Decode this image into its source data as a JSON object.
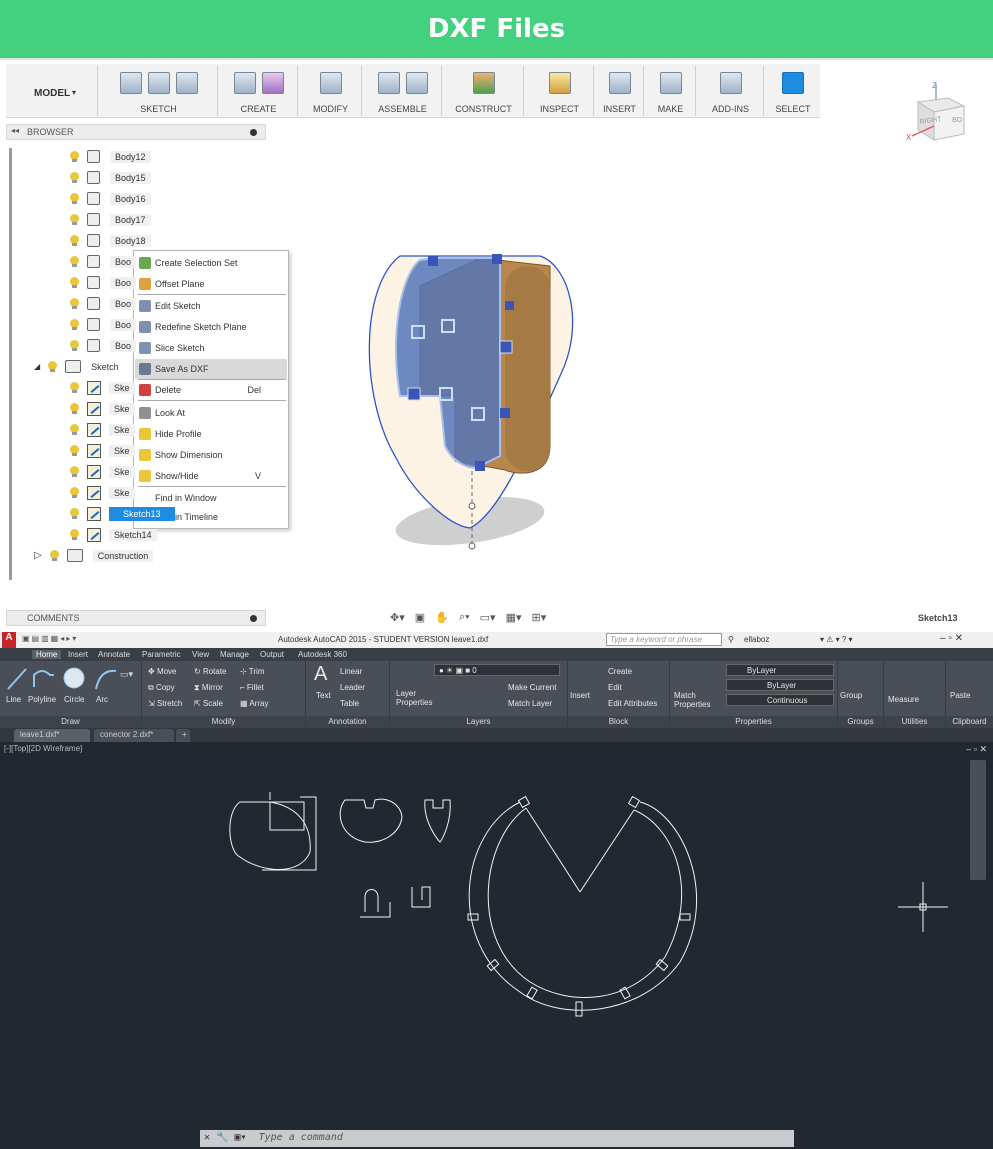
{
  "banner": {
    "title": "DXF Files"
  },
  "fusion": {
    "toolbar": {
      "workspace": "MODEL",
      "groups": [
        "SKETCH",
        "CREATE",
        "MODIFY",
        "ASSEMBLE",
        "CONSTRUCT",
        "INSPECT",
        "INSERT",
        "MAKE",
        "ADD-INS",
        "SELECT"
      ]
    },
    "viewcube": {
      "z": "Z",
      "x": "X",
      "face_right": "RIGHT",
      "face_back": "BO"
    },
    "browser": {
      "title": "BROWSER",
      "bodies": [
        "Body12",
        "Body15",
        "Body16",
        "Body17",
        "Body18",
        "Boo",
        "Boo",
        "Boo",
        "Boo",
        "Boo"
      ],
      "sketches_folder": "Sketch",
      "sketches": [
        "Ske",
        "Ske",
        "Ske",
        "Ske",
        "Ske",
        "Ske"
      ],
      "selected_sketch": "Sketch13",
      "next_sketch": "Sketch14",
      "construction": "Construction"
    },
    "context_menu": {
      "items": [
        {
          "label": "Create Selection Set",
          "shortcut": ""
        },
        {
          "label": "Offset Plane",
          "shortcut": ""
        },
        {
          "label": "Edit Sketch",
          "shortcut": ""
        },
        {
          "label": "Redefine Sketch Plane",
          "shortcut": ""
        },
        {
          "label": "Slice Sketch",
          "shortcut": ""
        },
        {
          "label": "Save As DXF",
          "shortcut": ""
        },
        {
          "label": "Delete",
          "shortcut": "Del"
        },
        {
          "label": "Look At",
          "shortcut": ""
        },
        {
          "label": "Hide Profile",
          "shortcut": ""
        },
        {
          "label": "Show Dimension",
          "shortcut": ""
        },
        {
          "label": "Show/Hide",
          "shortcut": "V"
        },
        {
          "label": "Find in Window",
          "shortcut": ""
        },
        {
          "label": "Find in Timeline",
          "shortcut": ""
        }
      ]
    },
    "comments": "COMMENTS",
    "active_sketch": "Sketch13"
  },
  "acad": {
    "title": "Autodesk AutoCAD 2015 - STUDENT VERSION   leave1.dxf",
    "search_placeholder": "Type a keyword or phrase",
    "user": "ellaboz",
    "tabs": [
      "Home",
      "Insert",
      "Annotate",
      "Parametric",
      "View",
      "Manage",
      "Output",
      "Autodesk 360"
    ],
    "draw": {
      "label": "Draw",
      "tools": [
        "Line",
        "Polyline",
        "Circle",
        "Arc"
      ]
    },
    "modify": {
      "label": "Modify",
      "tools": [
        "Move",
        "Rotate",
        "Trim",
        "Copy",
        "Mirror",
        "Fillet",
        "Stretch",
        "Scale",
        "Array"
      ]
    },
    "annotation": {
      "label": "Annotation",
      "tools": [
        "Text",
        "Linear",
        "Leader",
        "Table"
      ]
    },
    "layers": {
      "label": "Layers",
      "tools": [
        "Layer Properties",
        "Make Current",
        "Match Layer"
      ],
      "current_layer": "0"
    },
    "block": {
      "label": "Block",
      "tools": [
        "Insert",
        "Create",
        "Edit",
        "Edit Attributes"
      ]
    },
    "properties": {
      "label": "Properties",
      "match": "Match Properties",
      "color": "ByLayer",
      "linetype": "ByLayer",
      "lineweight": "Continuous"
    },
    "groups": {
      "label": "Groups",
      "tool": "Group"
    },
    "utilities": {
      "label": "Utilities",
      "tool": "Measure"
    },
    "clipboard": {
      "label": "Clipboard",
      "tool": "Paste"
    },
    "doc_tabs": [
      "leave1.dxf*",
      "conector 2.dxf*"
    ],
    "viewport_label": "[-][Top][2D Wireframe]",
    "command_placeholder": "Type a command"
  }
}
